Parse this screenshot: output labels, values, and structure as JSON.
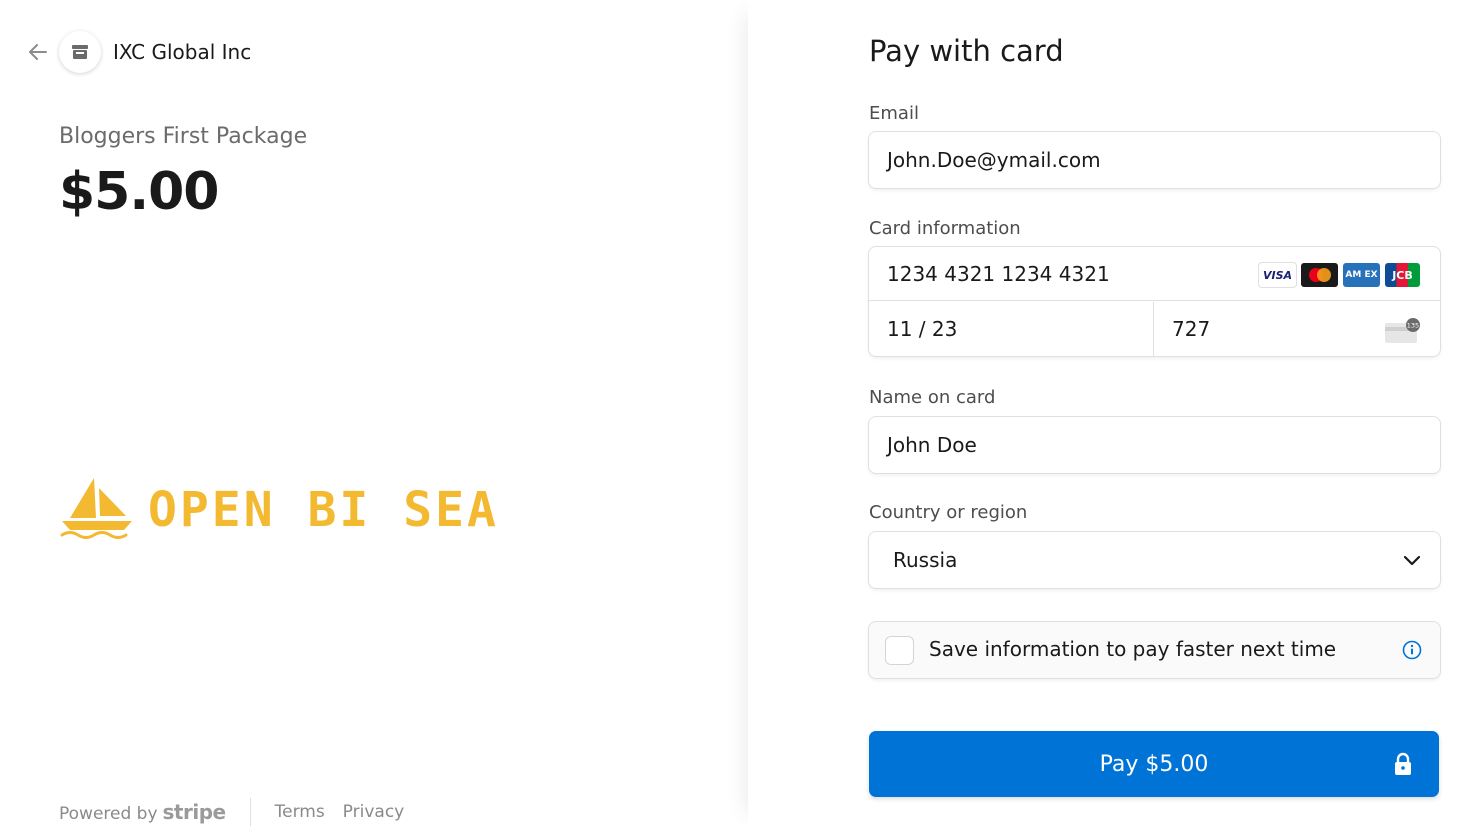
{
  "merchant": {
    "name": "IXC Global Inc",
    "back_icon": "arrow-left-icon",
    "store_icon": "store-icon"
  },
  "product": {
    "name": "Bloggers First Package",
    "price": "$5.00"
  },
  "logo": {
    "text": "OPEN BI SEA",
    "color": "#f2b931",
    "icon": "sailboat-icon"
  },
  "footer": {
    "powered_by": "Powered by",
    "stripe": "stripe",
    "terms": "Terms",
    "privacy": "Privacy"
  },
  "form": {
    "title": "Pay with card",
    "email": {
      "label": "Email",
      "value": "John.Doe@ymail.com"
    },
    "card": {
      "label": "Card information",
      "number": "1234 4321 1234 4321",
      "expiry": "11 / 23",
      "cvc": "727",
      "brands": [
        "visa-icon",
        "mastercard-icon",
        "amex-icon",
        "jcb-icon"
      ],
      "brand_text": {
        "visa": "VISA",
        "amex": "AM EX",
        "jcb": "JCB"
      },
      "cvc_hint": "135"
    },
    "name": {
      "label": "Name on card",
      "value": "John Doe"
    },
    "country": {
      "label": "Country or region",
      "value": "Russia"
    },
    "save": {
      "label": "Save information to pay faster next time",
      "checked": false
    },
    "pay_button": "Pay $5.00"
  },
  "colors": {
    "accent": "#0073d6",
    "logo": "#f2b931",
    "text": "#1a1a1a",
    "muted": "#6b6b6b"
  }
}
